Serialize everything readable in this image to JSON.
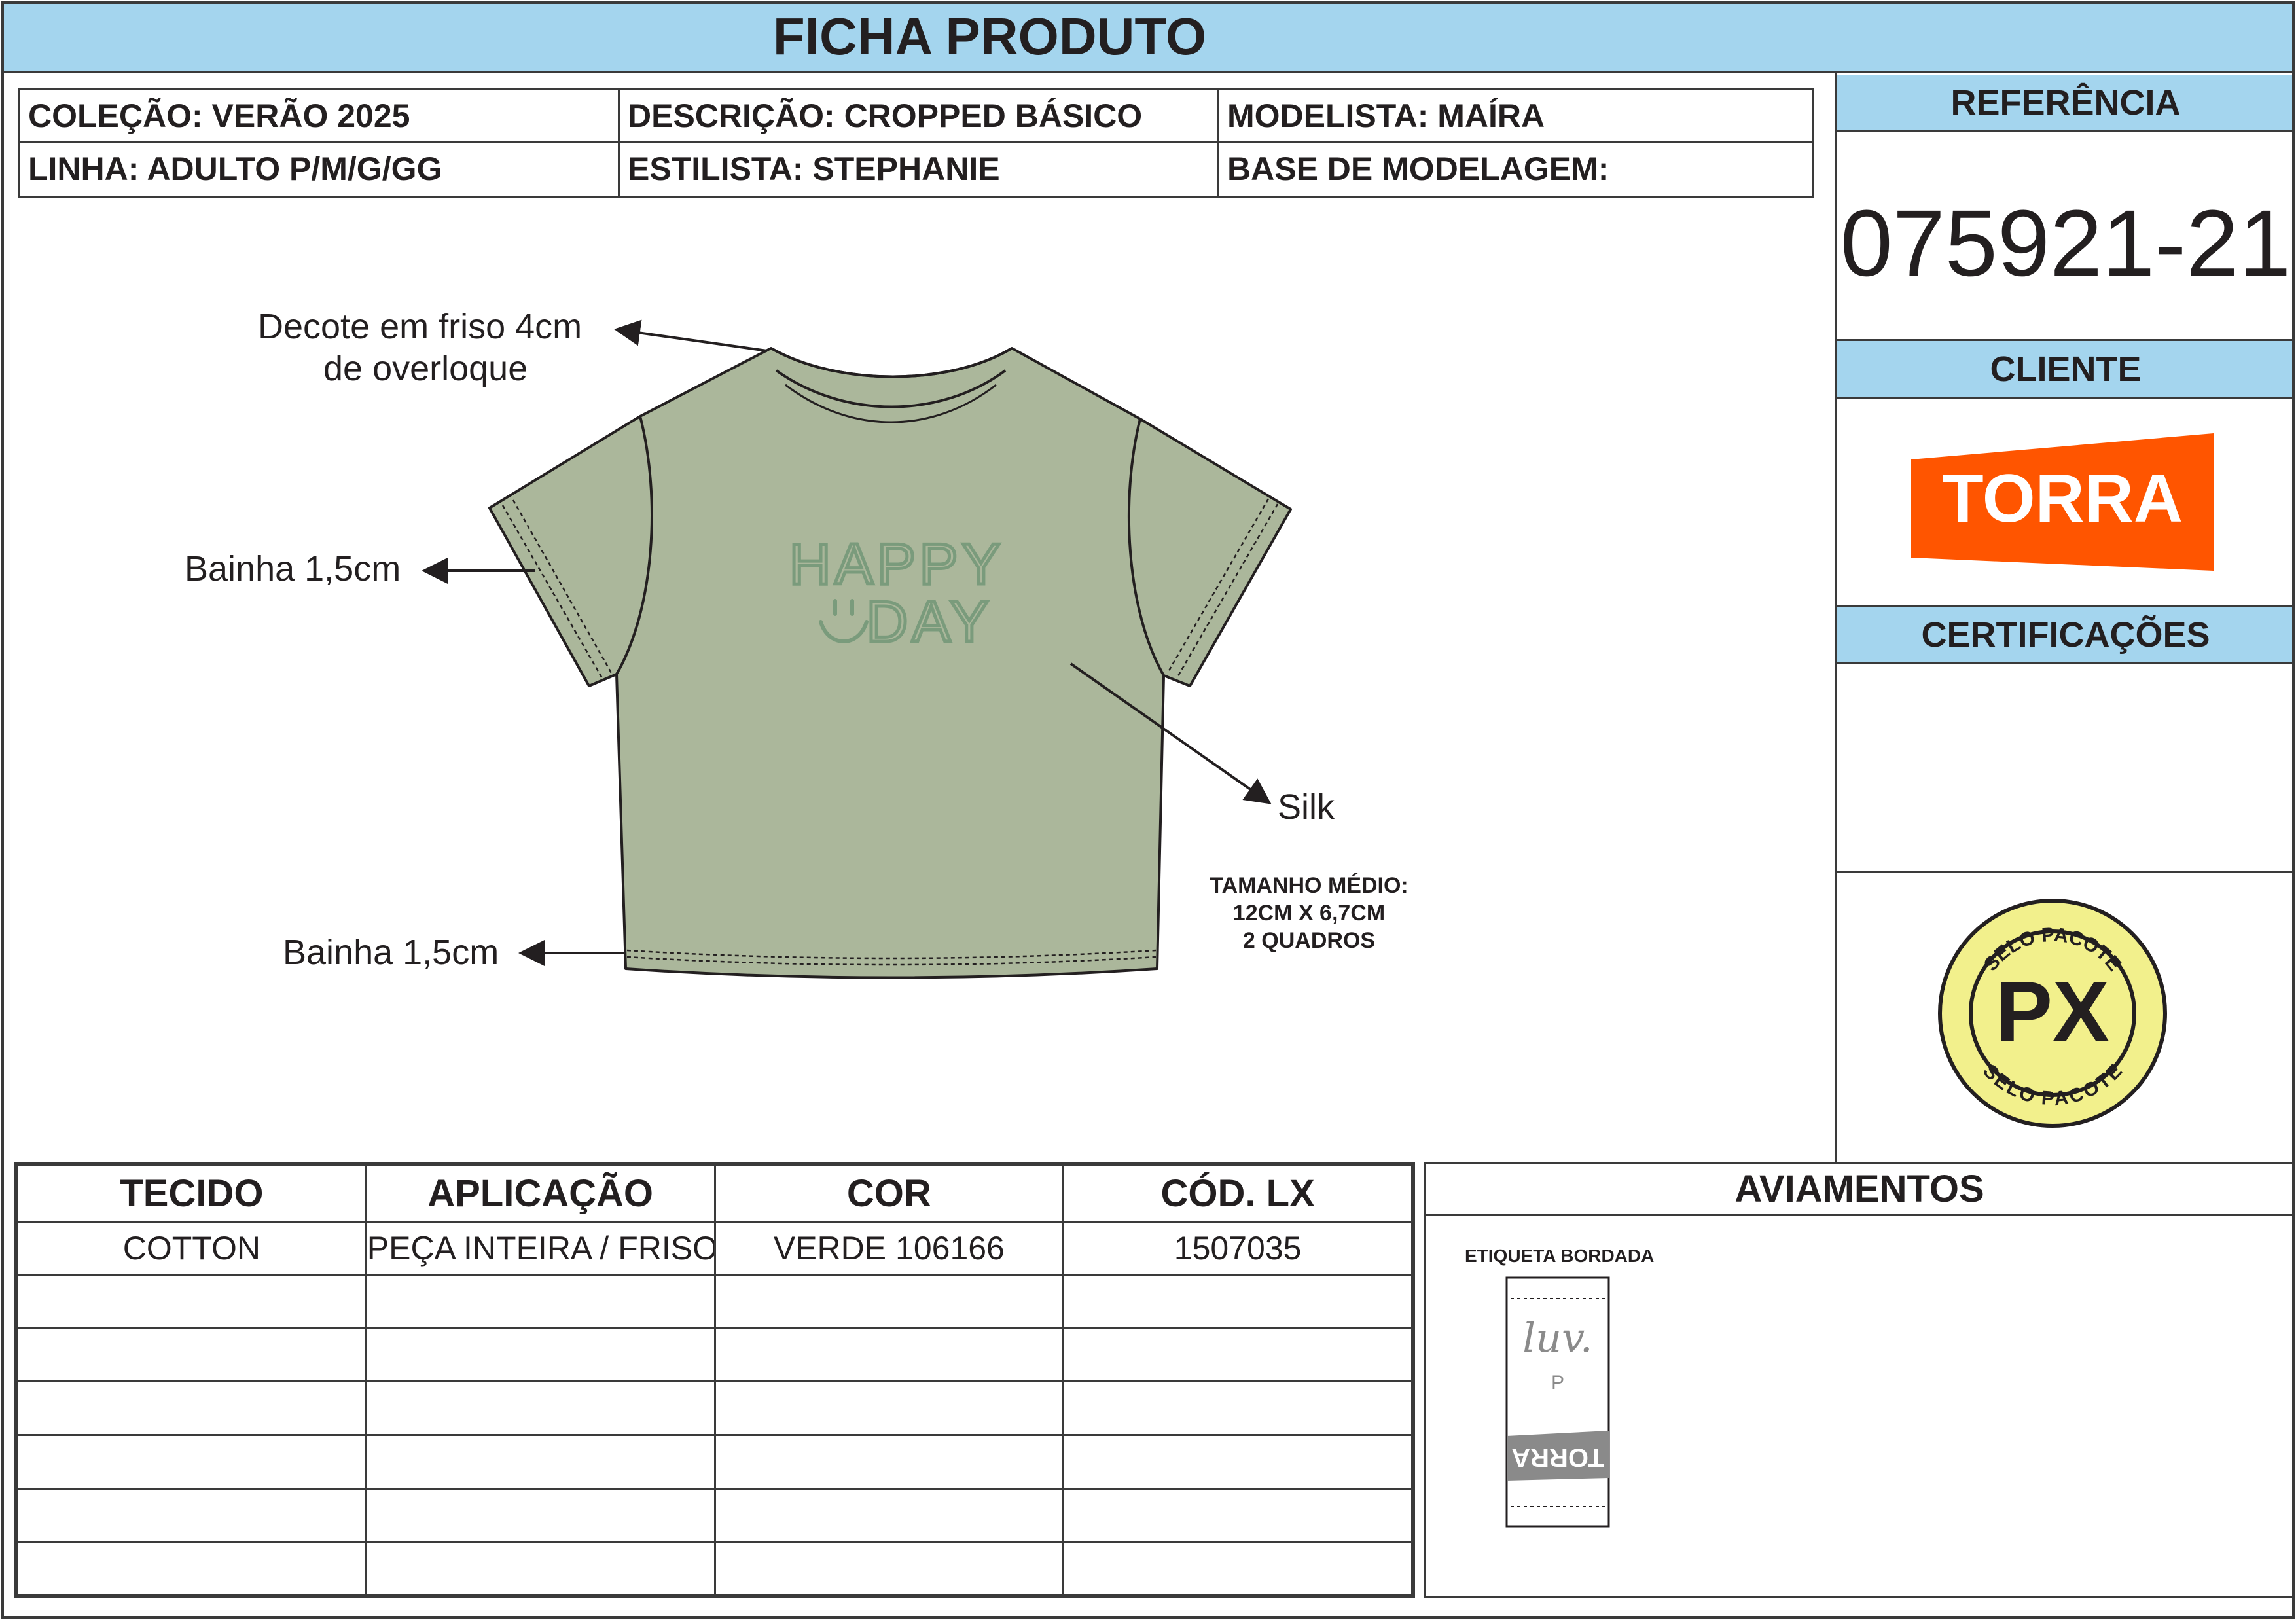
{
  "header": {
    "title": "FICHA PRODUTO"
  },
  "info": {
    "colecao": "COLEÇÃO: VERÃO 2025",
    "descricao": "DESCRIÇÃO: CROPPED BÁSICO",
    "modelista": "MODELISTA: MAÍRA",
    "linha": "LINHA: ADULTO P/M/G/GG",
    "estilista": "ESTILISTA: STEPHANIE",
    "base": "BASE DE MODELAGEM:"
  },
  "sidebar": {
    "referencia_label": "REFERÊNCIA",
    "referencia_value": "075921-21",
    "cliente_label": "CLIENTE",
    "cliente_logo": "TORRA",
    "cliente_logo_color": "#ff5500",
    "certificacoes_label": "CERTIFICAÇÕES",
    "selo": {
      "text": "PX",
      "ring_text": "SELO PACOTE",
      "color": "#f2f08c",
      "icon": "package-seal-icon"
    }
  },
  "garment": {
    "color": "#abb79b",
    "print_color": "#7a9b7c",
    "print_lines": [
      "HAPPY",
      "DAY"
    ],
    "callouts": {
      "neck_line1": "Decote em friso 4cm",
      "neck_line2": "de overloque",
      "sleeve_hem": "Bainha 1,5cm",
      "bottom_hem": "Bainha 1,5cm",
      "silk": "Silk"
    },
    "print_size": {
      "line1": "TAMANHO MÉDIO:",
      "line2": "12CM X 6,7CM",
      "line3": "2 QUADROS"
    }
  },
  "fabric_table": {
    "headers": [
      "TECIDO",
      "APLICAÇÃO",
      "COR",
      "CÓD. LX"
    ],
    "rows": [
      [
        "COTTON",
        "PEÇA INTEIRA / FRISO",
        "VERDE 106166",
        "1507035"
      ],
      [
        "",
        "",
        "",
        ""
      ],
      [
        "",
        "",
        "",
        ""
      ],
      [
        "",
        "",
        "",
        ""
      ],
      [
        "",
        "",
        "",
        ""
      ],
      [
        "",
        "",
        "",
        ""
      ],
      [
        "",
        "",
        "",
        ""
      ]
    ]
  },
  "aviamentos": {
    "title": "AVIAMENTOS",
    "item_label": "ETIQUETA BORDADA",
    "label_brand": "luv.",
    "label_size": "P",
    "label_logo": "TORRA"
  }
}
